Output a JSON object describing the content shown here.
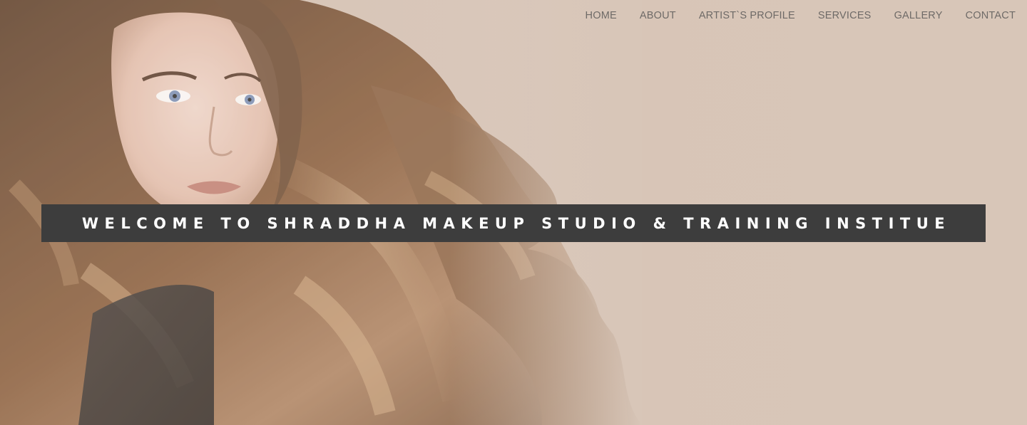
{
  "nav": {
    "items": [
      {
        "label": "HOME"
      },
      {
        "label": "ABOUT"
      },
      {
        "label": "ARTIST`S PROFILE"
      },
      {
        "label": "SERVICES"
      },
      {
        "label": "GALLERY"
      },
      {
        "label": "CONTACT"
      }
    ]
  },
  "hero": {
    "banner_text": "WELCOME TO SHRADDHA MAKEUP STUDIO & TRAINING INSTITUE",
    "background_image": "woman-with-long-wavy-brown-hair-photo"
  },
  "colors": {
    "background": "#d8c6b8",
    "banner": "#3d3d3d",
    "banner_text": "#ffffff",
    "nav_text": "#6e6a67",
    "hair": "#7a5232"
  }
}
